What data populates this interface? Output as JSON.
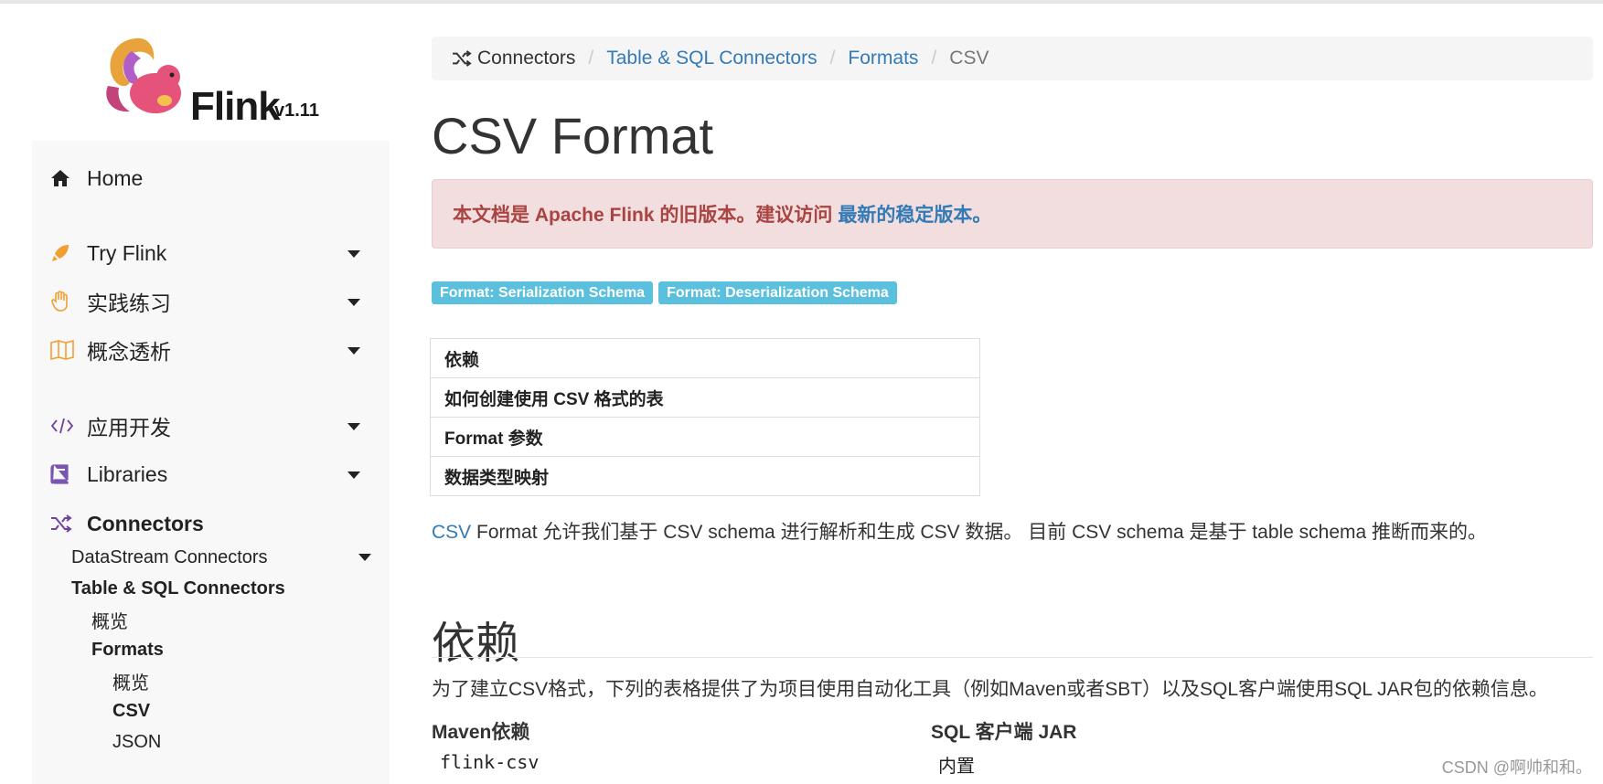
{
  "logo": {
    "name": "Flink",
    "version": "v1.11"
  },
  "sidebar": {
    "home": "Home",
    "try_flink": "Try Flink",
    "practice": "实践练习",
    "concepts": "概念透析",
    "app_dev": "应用开发",
    "libraries": "Libraries",
    "connectors": "Connectors",
    "datastream_connectors": "DataStream Connectors",
    "table_sql_connectors": "Table & SQL Connectors",
    "overview": "概览",
    "formats": "Formats",
    "formats_overview": "概览",
    "csv": "CSV",
    "json": "JSON"
  },
  "breadcrumb": {
    "root": "Connectors",
    "table_sql": "Table & SQL Connectors",
    "formats": "Formats",
    "current": "CSV"
  },
  "page": {
    "title": "CSV Format",
    "alert_text": "本文档是 Apache Flink 的旧版本。建议访问",
    "alert_link": "最新的稳定版本。",
    "badges": [
      "Format: Serialization Schema",
      "Format: Deserialization Schema"
    ],
    "toc": [
      "依赖",
      "如何创建使用 CSV 格式的表",
      "Format 参数",
      "数据类型映射"
    ],
    "intro_link": "CSV",
    "intro_text": " Format 允许我们基于 CSV schema 进行解析和生成 CSV 数据。 目前 CSV schema 是基于 table schema 推断而来的。",
    "dep_heading": "依赖",
    "dep_desc": "为了建立CSV格式，下列的表格提供了为项目使用自动化工具（例如Maven或者SBT）以及SQL客户端使用SQL JAR包的依赖信息。",
    "dep_table": {
      "headers": [
        "Maven依赖",
        "SQL 客户端 JAR"
      ],
      "rows": [
        [
          "flink-csv",
          "内置"
        ]
      ]
    }
  },
  "watermark": "CSDN @啊帅和和。",
  "colors": {
    "link": "#337ab7",
    "alert_bg": "#f2dede",
    "alert_text": "#a94442",
    "badge": "#5bc0de",
    "sidebar_bg": "#f8f8f8"
  },
  "icons": [
    "home-icon",
    "rocket-icon",
    "hand-icon",
    "book-open-icon",
    "code-icon",
    "book-icon",
    "shuffle-icon"
  ]
}
